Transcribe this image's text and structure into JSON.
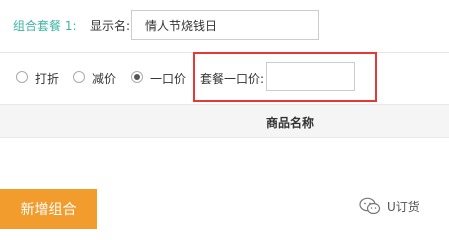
{
  "combo": {
    "group_label": "组合套餐 1:",
    "display_name_label": "显示名:",
    "display_name_value": "情人节烧钱日"
  },
  "pricing": {
    "options": [
      {
        "label": "打折",
        "selected": false
      },
      {
        "label": "减价",
        "selected": false
      },
      {
        "label": "一口价",
        "selected": true
      }
    ],
    "fixed_price_label": "套餐一口价:",
    "fixed_price_value": ""
  },
  "table": {
    "columns": [
      "商品名称"
    ]
  },
  "actions": {
    "add_group_label": "新增组合"
  },
  "watermark": {
    "icon": "wechat-icon",
    "text": "U订货"
  },
  "colors": {
    "accent_teal": "#3bb4a5",
    "button_orange": "#f39c2e",
    "highlight_red": "#e53935"
  }
}
